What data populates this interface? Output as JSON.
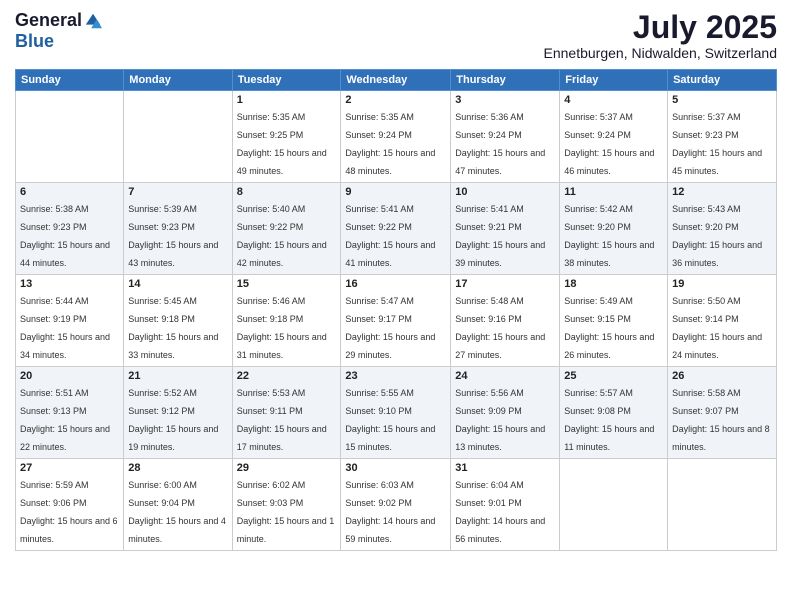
{
  "logo": {
    "general": "General",
    "blue": "Blue"
  },
  "title": "July 2025",
  "location": "Ennetburgen, Nidwalden, Switzerland",
  "weekdays": [
    "Sunday",
    "Monday",
    "Tuesday",
    "Wednesday",
    "Thursday",
    "Friday",
    "Saturday"
  ],
  "weeks": [
    [
      {
        "day": "",
        "sunrise": "",
        "sunset": "",
        "daylight": ""
      },
      {
        "day": "",
        "sunrise": "",
        "sunset": "",
        "daylight": ""
      },
      {
        "day": "1",
        "sunrise": "Sunrise: 5:35 AM",
        "sunset": "Sunset: 9:25 PM",
        "daylight": "Daylight: 15 hours and 49 minutes."
      },
      {
        "day": "2",
        "sunrise": "Sunrise: 5:35 AM",
        "sunset": "Sunset: 9:24 PM",
        "daylight": "Daylight: 15 hours and 48 minutes."
      },
      {
        "day": "3",
        "sunrise": "Sunrise: 5:36 AM",
        "sunset": "Sunset: 9:24 PM",
        "daylight": "Daylight: 15 hours and 47 minutes."
      },
      {
        "day": "4",
        "sunrise": "Sunrise: 5:37 AM",
        "sunset": "Sunset: 9:24 PM",
        "daylight": "Daylight: 15 hours and 46 minutes."
      },
      {
        "day": "5",
        "sunrise": "Sunrise: 5:37 AM",
        "sunset": "Sunset: 9:23 PM",
        "daylight": "Daylight: 15 hours and 45 minutes."
      }
    ],
    [
      {
        "day": "6",
        "sunrise": "Sunrise: 5:38 AM",
        "sunset": "Sunset: 9:23 PM",
        "daylight": "Daylight: 15 hours and 44 minutes."
      },
      {
        "day": "7",
        "sunrise": "Sunrise: 5:39 AM",
        "sunset": "Sunset: 9:23 PM",
        "daylight": "Daylight: 15 hours and 43 minutes."
      },
      {
        "day": "8",
        "sunrise": "Sunrise: 5:40 AM",
        "sunset": "Sunset: 9:22 PM",
        "daylight": "Daylight: 15 hours and 42 minutes."
      },
      {
        "day": "9",
        "sunrise": "Sunrise: 5:41 AM",
        "sunset": "Sunset: 9:22 PM",
        "daylight": "Daylight: 15 hours and 41 minutes."
      },
      {
        "day": "10",
        "sunrise": "Sunrise: 5:41 AM",
        "sunset": "Sunset: 9:21 PM",
        "daylight": "Daylight: 15 hours and 39 minutes."
      },
      {
        "day": "11",
        "sunrise": "Sunrise: 5:42 AM",
        "sunset": "Sunset: 9:20 PM",
        "daylight": "Daylight: 15 hours and 38 minutes."
      },
      {
        "day": "12",
        "sunrise": "Sunrise: 5:43 AM",
        "sunset": "Sunset: 9:20 PM",
        "daylight": "Daylight: 15 hours and 36 minutes."
      }
    ],
    [
      {
        "day": "13",
        "sunrise": "Sunrise: 5:44 AM",
        "sunset": "Sunset: 9:19 PM",
        "daylight": "Daylight: 15 hours and 34 minutes."
      },
      {
        "day": "14",
        "sunrise": "Sunrise: 5:45 AM",
        "sunset": "Sunset: 9:18 PM",
        "daylight": "Daylight: 15 hours and 33 minutes."
      },
      {
        "day": "15",
        "sunrise": "Sunrise: 5:46 AM",
        "sunset": "Sunset: 9:18 PM",
        "daylight": "Daylight: 15 hours and 31 minutes."
      },
      {
        "day": "16",
        "sunrise": "Sunrise: 5:47 AM",
        "sunset": "Sunset: 9:17 PM",
        "daylight": "Daylight: 15 hours and 29 minutes."
      },
      {
        "day": "17",
        "sunrise": "Sunrise: 5:48 AM",
        "sunset": "Sunset: 9:16 PM",
        "daylight": "Daylight: 15 hours and 27 minutes."
      },
      {
        "day": "18",
        "sunrise": "Sunrise: 5:49 AM",
        "sunset": "Sunset: 9:15 PM",
        "daylight": "Daylight: 15 hours and 26 minutes."
      },
      {
        "day": "19",
        "sunrise": "Sunrise: 5:50 AM",
        "sunset": "Sunset: 9:14 PM",
        "daylight": "Daylight: 15 hours and 24 minutes."
      }
    ],
    [
      {
        "day": "20",
        "sunrise": "Sunrise: 5:51 AM",
        "sunset": "Sunset: 9:13 PM",
        "daylight": "Daylight: 15 hours and 22 minutes."
      },
      {
        "day": "21",
        "sunrise": "Sunrise: 5:52 AM",
        "sunset": "Sunset: 9:12 PM",
        "daylight": "Daylight: 15 hours and 19 minutes."
      },
      {
        "day": "22",
        "sunrise": "Sunrise: 5:53 AM",
        "sunset": "Sunset: 9:11 PM",
        "daylight": "Daylight: 15 hours and 17 minutes."
      },
      {
        "day": "23",
        "sunrise": "Sunrise: 5:55 AM",
        "sunset": "Sunset: 9:10 PM",
        "daylight": "Daylight: 15 hours and 15 minutes."
      },
      {
        "day": "24",
        "sunrise": "Sunrise: 5:56 AM",
        "sunset": "Sunset: 9:09 PM",
        "daylight": "Daylight: 15 hours and 13 minutes."
      },
      {
        "day": "25",
        "sunrise": "Sunrise: 5:57 AM",
        "sunset": "Sunset: 9:08 PM",
        "daylight": "Daylight: 15 hours and 11 minutes."
      },
      {
        "day": "26",
        "sunrise": "Sunrise: 5:58 AM",
        "sunset": "Sunset: 9:07 PM",
        "daylight": "Daylight: 15 hours and 8 minutes."
      }
    ],
    [
      {
        "day": "27",
        "sunrise": "Sunrise: 5:59 AM",
        "sunset": "Sunset: 9:06 PM",
        "daylight": "Daylight: 15 hours and 6 minutes."
      },
      {
        "day": "28",
        "sunrise": "Sunrise: 6:00 AM",
        "sunset": "Sunset: 9:04 PM",
        "daylight": "Daylight: 15 hours and 4 minutes."
      },
      {
        "day": "29",
        "sunrise": "Sunrise: 6:02 AM",
        "sunset": "Sunset: 9:03 PM",
        "daylight": "Daylight: 15 hours and 1 minute."
      },
      {
        "day": "30",
        "sunrise": "Sunrise: 6:03 AM",
        "sunset": "Sunset: 9:02 PM",
        "daylight": "Daylight: 14 hours and 59 minutes."
      },
      {
        "day": "31",
        "sunrise": "Sunrise: 6:04 AM",
        "sunset": "Sunset: 9:01 PM",
        "daylight": "Daylight: 14 hours and 56 minutes."
      },
      {
        "day": "",
        "sunrise": "",
        "sunset": "",
        "daylight": ""
      },
      {
        "day": "",
        "sunrise": "",
        "sunset": "",
        "daylight": ""
      }
    ]
  ]
}
